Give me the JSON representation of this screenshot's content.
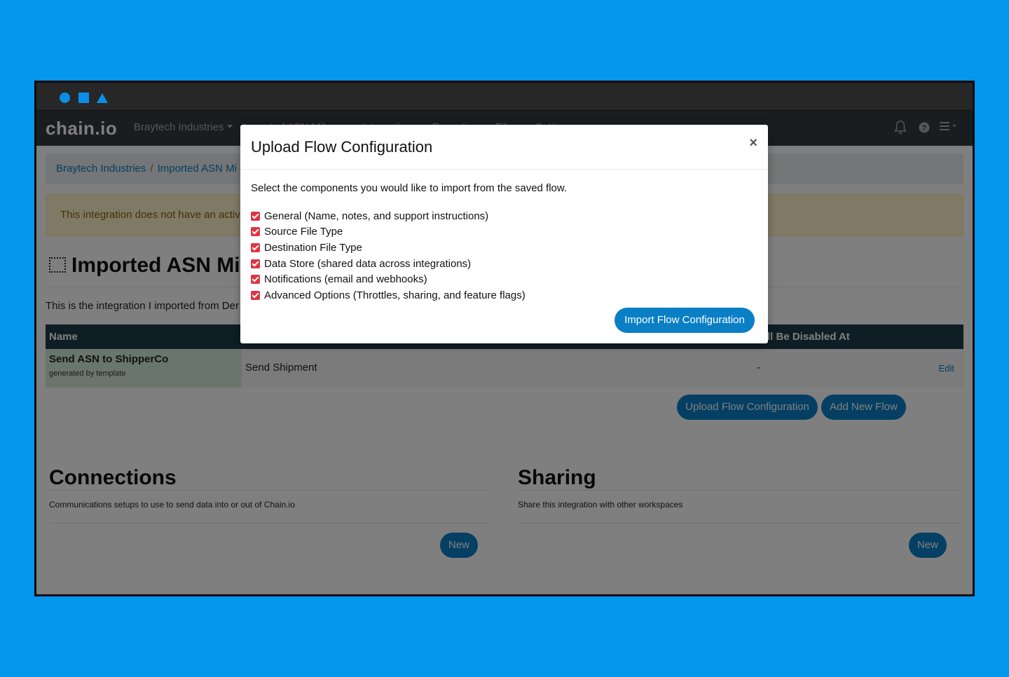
{
  "window": {
    "controls": [
      "circle-icon",
      "square-icon",
      "triangle-icon"
    ]
  },
  "navbar": {
    "logo": "chain.io",
    "company_menu": "Braytech Industries",
    "items": [
      "Imported ASN Mil...",
      "Integrations",
      "Executions",
      "Files",
      "Settings"
    ],
    "icons": [
      "bell-icon",
      "help-icon",
      "menu-icon"
    ]
  },
  "breadcrumb": {
    "items": [
      "Braytech Industries",
      "Imported ASN Mi"
    ]
  },
  "alert": {
    "text": "This integration does not have an activ"
  },
  "page": {
    "title": "Imported ASN Mil",
    "description": "This is the integration I imported from Der"
  },
  "flows_table": {
    "headers": [
      "Name",
      "ll Be Disabled At"
    ],
    "rows": [
      {
        "name": "Send ASN to ShipperCo",
        "subtitle": "generated by template",
        "type": "Send Shipment",
        "disabled_at": "-",
        "edit": "Edit"
      }
    ]
  },
  "flow_actions": {
    "upload": "Upload Flow Configuration",
    "add": "Add New Flow"
  },
  "connections": {
    "title": "Connections",
    "description": "Communications setups to use to send data into or out of Chain.io",
    "new_button": "New"
  },
  "sharing": {
    "title": "Sharing",
    "description": "Share this integration with other workspaces",
    "new_button": "New"
  },
  "modal": {
    "title": "Upload Flow Configuration",
    "close": "×",
    "intro": "Select the components you would like to import from the saved flow.",
    "options": [
      {
        "label": "General (Name, notes, and support instructions)",
        "checked": true
      },
      {
        "label": "Source File Type",
        "checked": true
      },
      {
        "label": "Destination File Type",
        "checked": true
      },
      {
        "label": "Data Store (shared data across integrations)",
        "checked": true
      },
      {
        "label": "Notifications (email and webhooks)",
        "checked": true
      },
      {
        "label": "Advanced Options (Throttles, sharing, and feature flags)",
        "checked": true
      }
    ],
    "submit": "Import Flow Configuration"
  }
}
